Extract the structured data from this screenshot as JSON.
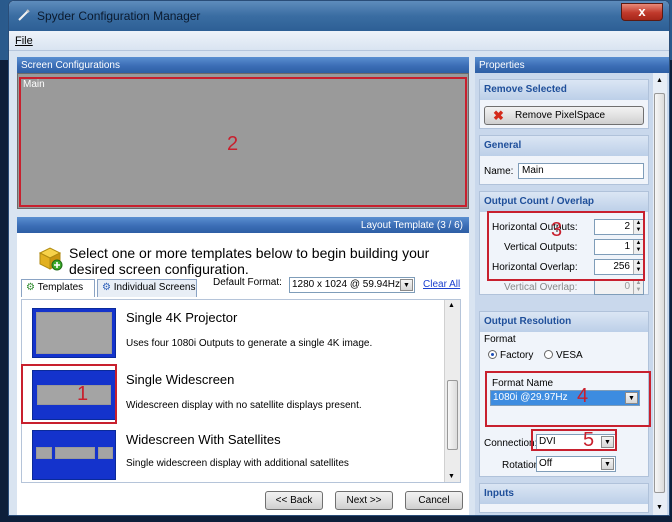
{
  "window": {
    "title": "Spyder Configuration Manager",
    "close": "x"
  },
  "menu": {
    "file": "File"
  },
  "screen_configs": {
    "header": "Screen Configurations",
    "item": "Main",
    "marker": "2"
  },
  "layout": {
    "header": "Layout Template (3 / 6)",
    "intro": "Select one or more templates below to begin building your desired screen configuration.",
    "tabs": [
      "Templates",
      "Individual Screens"
    ],
    "default_format_label": "Default Format:",
    "default_format_value": "1280 x 1024 @ 59.94Hz",
    "clear_all": "Clear All",
    "templates": [
      {
        "title": "Single 4K Projector",
        "desc": "Uses four 1080i Outputs to generate a single 4K image."
      },
      {
        "title": "Single Widescreen",
        "desc": "Widescreen display with no satellite displays present."
      },
      {
        "title": "Widescreen With Satellites",
        "desc": "Single widescreen display with additional satellites"
      }
    ],
    "marker": "1",
    "buttons": {
      "back": "<< Back",
      "next": "Next >>",
      "cancel": "Cancel"
    }
  },
  "properties": {
    "header": "Properties",
    "remove_selected": {
      "title": "Remove Selected",
      "button": "Remove PixelSpace"
    },
    "general": {
      "title": "General",
      "name_label": "Name:",
      "name_value": "Main"
    },
    "output_count": {
      "title": "Output Count / Overlap",
      "h_outputs_label": "Horizontal Outputs:",
      "h_outputs": "2",
      "v_outputs_label": "Vertical Outputs:",
      "v_outputs": "1",
      "h_overlap_label": "Horizontal Overlap:",
      "h_overlap": "256",
      "v_overlap_label": "Vertical Overlap:",
      "v_overlap": "0",
      "marker": "3"
    },
    "output_resolution": {
      "title": "Output Resolution",
      "format_label": "Format",
      "factory": "Factory",
      "vesa": "VESA",
      "format_name_label": "Format Name",
      "format_name_value": "1080i @29.97Hz",
      "marker": "4",
      "connection_label": "Connection:",
      "connection_value": "DVI",
      "connection_marker": "5",
      "rotation_label": "Rotation:",
      "rotation_value": "Off"
    },
    "inputs": {
      "title": "Inputs"
    }
  }
}
